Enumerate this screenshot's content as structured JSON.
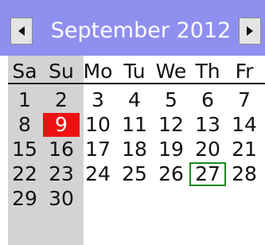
{
  "header": {
    "title": "September 2012",
    "prev_icon": "arrow-left-icon",
    "next_icon": "arrow-right-icon"
  },
  "weekdays": [
    "Sa",
    "Su",
    "Mo",
    "Tu",
    "We",
    "Th",
    "Fr"
  ],
  "weeks": [
    [
      "1",
      "2",
      "3",
      "4",
      "5",
      "6",
      "7"
    ],
    [
      "8",
      "9",
      "10",
      "11",
      "12",
      "13",
      "14"
    ],
    [
      "15",
      "16",
      "17",
      "18",
      "19",
      "20",
      "21"
    ],
    [
      "22",
      "23",
      "24",
      "25",
      "26",
      "27",
      "28"
    ],
    [
      "29",
      "30",
      "",
      "",
      "",
      "",
      ""
    ]
  ],
  "selected_day": "9",
  "today_day": "27",
  "colors": {
    "header_bg": "#8f8ff0",
    "weekend_bg": "#d3d3d3",
    "selected_bg": "#ee1111",
    "today_border": "#1a8a1a"
  }
}
